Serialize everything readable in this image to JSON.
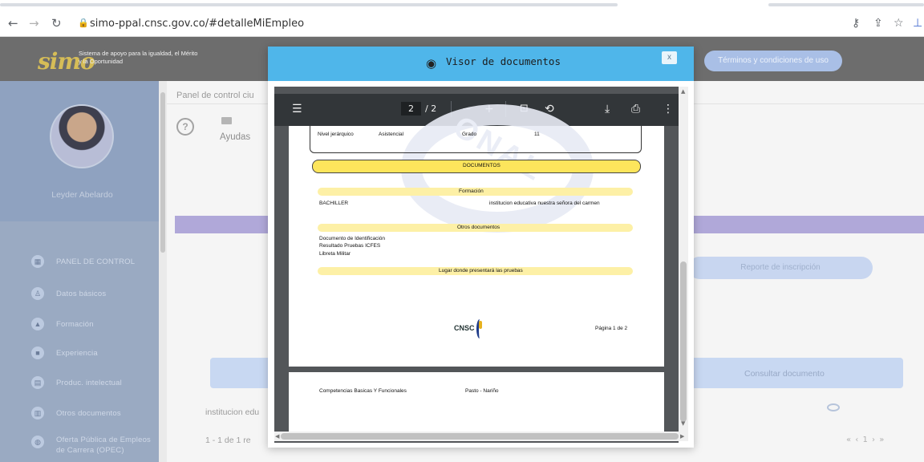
{
  "browser": {
    "url": "simo-ppal.cnsc.gov.co/#detalleMiEmpleo",
    "back_icon": "arrow-left",
    "forward_icon": "arrow-right",
    "reload_icon": "reload",
    "lock_icon": "lock"
  },
  "header": {
    "logo": "simo",
    "tagline": "Sistema de apoyo para la igualdad, el Mérito y la Oportunidad",
    "terms_label": "Términos y condiciones de uso"
  },
  "sidebar": {
    "user_name": "Leyder Abelardo",
    "items": [
      {
        "label": "PANEL DE CONTROL",
        "icon": "grid-icon"
      },
      {
        "label": "Datos básicos",
        "icon": "people-icon"
      },
      {
        "label": "Formación",
        "icon": "graduation-icon"
      },
      {
        "label": "Experiencia",
        "icon": "briefcase-icon"
      },
      {
        "label": "Produc. intelectual",
        "icon": "book-icon"
      },
      {
        "label": "Otros documentos",
        "icon": "document-icon"
      },
      {
        "label": "Oferta Pública de Empleos de Carrera (OPEC)",
        "icon": "globe-icon"
      }
    ]
  },
  "main": {
    "panel_title": "Panel de control ciu",
    "help_label": "Ayudas",
    "report_label": "Reporte de inscripción",
    "consult_label": "Consultar documento",
    "institution_text": "institucion edu",
    "paging_text": "1 - 1 de 1 re",
    "pager": "« ‹ 1 › »"
  },
  "modal": {
    "title": "Visor de documentos",
    "close_label": "x"
  },
  "pdf": {
    "current_page": "2",
    "total_pages": "/ 2",
    "zoom_out": "−",
    "zoom_in": "+",
    "page1": {
      "nivel_label": "Nivel jerárquico",
      "nivel_value": "Asistencial",
      "grado_label": "Grado",
      "grado_value": "11",
      "documents_header": "DOCUMENTOS",
      "formacion_header": "Formación",
      "formacion_item": "BACHILLER",
      "formacion_institution": "institucion educativa nuestra señora del carmen",
      "otros_header": "Otros documentos",
      "otros_items": [
        "Documento de Identificación",
        "Resultado Pruebas ICFES",
        "Libreta Militar"
      ],
      "lugar_header": "Lugar donde presentará las pruebas",
      "logo_text": "CNSC",
      "page_footer": "Página 1 de 2"
    },
    "page2": {
      "competencias": "Competencias Basicas Y Funcionales",
      "lugar_value": "Pasto - Nariño"
    }
  }
}
